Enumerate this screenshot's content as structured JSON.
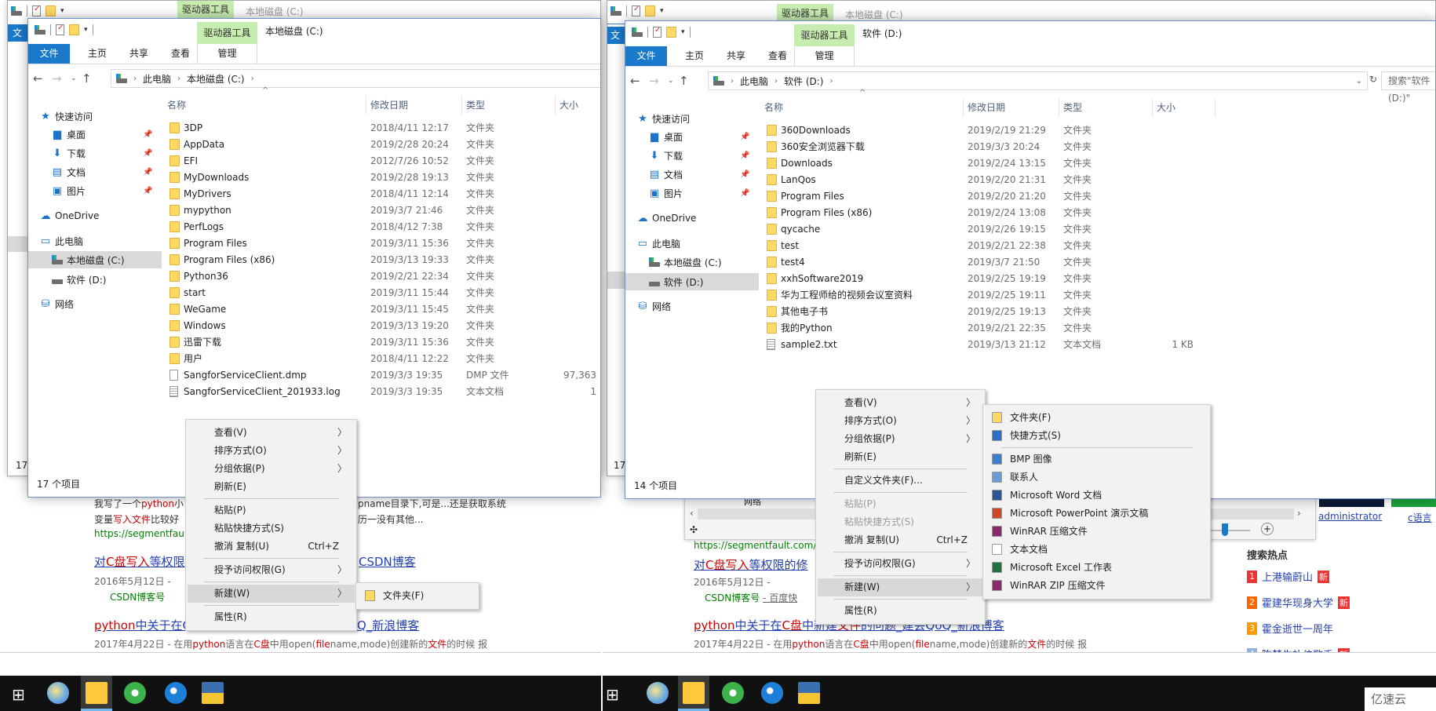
{
  "background_windows": [
    {
      "context_tab": "驱动器工具",
      "title": "本地磁盘 (C:)",
      "file_tab": "文",
      "status_fragment": "17"
    },
    {
      "context_tab": "驱动器工具",
      "title": "本地磁盘 (C:)",
      "file_tab": "文",
      "status_fragment": "17"
    }
  ],
  "windows": [
    {
      "context_tab": "驱动器工具",
      "title": "本地磁盘 (C:)",
      "tabs": [
        "文件",
        "主页",
        "共享",
        "查看"
      ],
      "context_subtab": "管理",
      "breadcrumb": [
        "此电脑",
        "本地磁盘 (C:)"
      ],
      "columns": [
        "名称",
        "修改日期",
        "类型",
        "大小"
      ],
      "nav": [
        {
          "label": "快速访问",
          "icon": "star",
          "level": 0
        },
        {
          "label": "桌面",
          "icon": "desktop",
          "level": 1,
          "pinned": true
        },
        {
          "label": "下载",
          "icon": "download",
          "level": 1,
          "pinned": true
        },
        {
          "label": "文档",
          "icon": "document",
          "level": 1,
          "pinned": true
        },
        {
          "label": "图片",
          "icon": "picture",
          "level": 1,
          "pinned": true
        },
        {
          "label": "OneDrive",
          "icon": "cloud",
          "level": 0
        },
        {
          "label": "此电脑",
          "icon": "computer",
          "level": 0
        },
        {
          "label": "本地磁盘 (C:)",
          "icon": "system-drive",
          "level": 1,
          "selected": true
        },
        {
          "label": "软件 (D:)",
          "icon": "drive",
          "level": 1
        },
        {
          "label": "网络",
          "icon": "network",
          "level": 0
        }
      ],
      "files": [
        {
          "name": "3DP",
          "date": "2018/4/11 12:17",
          "type": "文件夹",
          "size": "",
          "icon": "folder"
        },
        {
          "name": "AppData",
          "date": "2019/2/28 20:24",
          "type": "文件夹",
          "size": "",
          "icon": "folder"
        },
        {
          "name": "EFI",
          "date": "2012/7/26 10:52",
          "type": "文件夹",
          "size": "",
          "icon": "folder"
        },
        {
          "name": "MyDownloads",
          "date": "2019/2/28 19:13",
          "type": "文件夹",
          "size": "",
          "icon": "folder"
        },
        {
          "name": "MyDrivers",
          "date": "2018/4/11 12:14",
          "type": "文件夹",
          "size": "",
          "icon": "folder"
        },
        {
          "name": "mypython",
          "date": "2019/3/7 21:46",
          "type": "文件夹",
          "size": "",
          "icon": "folder"
        },
        {
          "name": "PerfLogs",
          "date": "2018/4/12 7:38",
          "type": "文件夹",
          "size": "",
          "icon": "folder"
        },
        {
          "name": "Program Files",
          "date": "2019/3/11 15:36",
          "type": "文件夹",
          "size": "",
          "icon": "folder"
        },
        {
          "name": "Program Files (x86)",
          "date": "2019/3/13 19:33",
          "type": "文件夹",
          "size": "",
          "icon": "folder"
        },
        {
          "name": "Python36",
          "date": "2019/2/21 22:34",
          "type": "文件夹",
          "size": "",
          "icon": "folder"
        },
        {
          "name": "start",
          "date": "2019/3/11 15:44",
          "type": "文件夹",
          "size": "",
          "icon": "folder"
        },
        {
          "name": "WeGame",
          "date": "2019/3/11 15:45",
          "type": "文件夹",
          "size": "",
          "icon": "folder"
        },
        {
          "name": "Windows",
          "date": "2019/3/13 19:20",
          "type": "文件夹",
          "size": "",
          "icon": "folder"
        },
        {
          "name": "迅雷下载",
          "date": "2019/3/11 15:36",
          "type": "文件夹",
          "size": "",
          "icon": "folder"
        },
        {
          "name": "用户",
          "date": "2018/4/11 12:22",
          "type": "文件夹",
          "size": "",
          "icon": "folder"
        },
        {
          "name": "SangforServiceClient.dmp",
          "date": "2019/3/3 19:35",
          "type": "DMP 文件",
          "size": "97,363",
          "icon": "file"
        },
        {
          "name": "SangforServiceClient_201933.log",
          "date": "2019/3/3 19:35",
          "type": "文本文档",
          "size": "1",
          "icon": "text-file"
        }
      ],
      "status": "17 个项目"
    },
    {
      "context_tab": "驱动器工具",
      "title": "软件 (D:)",
      "tabs": [
        "文件",
        "主页",
        "共享",
        "查看"
      ],
      "context_subtab": "管理",
      "breadcrumb": [
        "此电脑",
        "软件 (D:)"
      ],
      "search_placeholder": "搜索\"软件 (D:)\"",
      "columns": [
        "名称",
        "修改日期",
        "类型",
        "大小"
      ],
      "nav": [
        {
          "label": "快速访问",
          "icon": "star",
          "level": 0
        },
        {
          "label": "桌面",
          "icon": "desktop",
          "level": 1,
          "pinned": true
        },
        {
          "label": "下载",
          "icon": "download",
          "level": 1,
          "pinned": true
        },
        {
          "label": "文档",
          "icon": "document",
          "level": 1,
          "pinned": true
        },
        {
          "label": "图片",
          "icon": "picture",
          "level": 1,
          "pinned": true
        },
        {
          "label": "OneDrive",
          "icon": "cloud",
          "level": 0
        },
        {
          "label": "此电脑",
          "icon": "computer",
          "level": 0
        },
        {
          "label": "本地磁盘 (C:)",
          "icon": "system-drive",
          "level": 1
        },
        {
          "label": "软件 (D:)",
          "icon": "drive",
          "level": 1,
          "selected": true
        },
        {
          "label": "网络",
          "icon": "network",
          "level": 0
        }
      ],
      "files": [
        {
          "name": "360Downloads",
          "date": "2019/2/19 21:29",
          "type": "文件夹",
          "size": "",
          "icon": "folder"
        },
        {
          "name": "360安全浏览器下载",
          "date": "2019/3/3 20:24",
          "type": "文件夹",
          "size": "",
          "icon": "folder"
        },
        {
          "name": "Downloads",
          "date": "2019/2/24 13:15",
          "type": "文件夹",
          "size": "",
          "icon": "folder"
        },
        {
          "name": "LanQos",
          "date": "2019/2/20 21:31",
          "type": "文件夹",
          "size": "",
          "icon": "folder"
        },
        {
          "name": "Program Files",
          "date": "2019/2/20 21:20",
          "type": "文件夹",
          "size": "",
          "icon": "folder"
        },
        {
          "name": "Program Files (x86)",
          "date": "2019/2/24 13:08",
          "type": "文件夹",
          "size": "",
          "icon": "folder"
        },
        {
          "name": "qycache",
          "date": "2019/2/26 19:15",
          "type": "文件夹",
          "size": "",
          "icon": "folder"
        },
        {
          "name": "test",
          "date": "2019/2/21 22:38",
          "type": "文件夹",
          "size": "",
          "icon": "folder"
        },
        {
          "name": "test4",
          "date": "2019/3/7 21:50",
          "type": "文件夹",
          "size": "",
          "icon": "folder"
        },
        {
          "name": "xxhSoftware2019",
          "date": "2019/2/25 19:19",
          "type": "文件夹",
          "size": "",
          "icon": "folder"
        },
        {
          "name": "华为工程师给的视频会议室资料",
          "date": "2019/2/25 19:11",
          "type": "文件夹",
          "size": "",
          "icon": "folder"
        },
        {
          "name": "其他电子书",
          "date": "2019/2/25 19:13",
          "type": "文件夹",
          "size": "",
          "icon": "folder"
        },
        {
          "name": "我的Python",
          "date": "2019/2/21 22:35",
          "type": "文件夹",
          "size": "",
          "icon": "folder"
        },
        {
          "name": "sample2.txt",
          "date": "2019/3/13 21:12",
          "type": "文本文档",
          "size": "1 KB",
          "icon": "text-file"
        }
      ],
      "status": "14 个项目"
    }
  ],
  "context_menus": [
    {
      "items": [
        {
          "label": "查看(V)",
          "submenu": true
        },
        {
          "label": "排序方式(O)",
          "submenu": true
        },
        {
          "label": "分组依据(P)",
          "submenu": true
        },
        {
          "label": "刷新(E)"
        },
        {
          "separator": true
        },
        {
          "label": "粘贴(P)"
        },
        {
          "label": "粘贴快捷方式(S)"
        },
        {
          "label": "撤消 复制(U)",
          "shortcut": "Ctrl+Z"
        },
        {
          "separator": true
        },
        {
          "label": "授予访问权限(G)",
          "submenu": true
        },
        {
          "separator": true
        },
        {
          "label": "新建(W)",
          "submenu": true,
          "highlighted": true
        },
        {
          "separator": true
        },
        {
          "label": "属性(R)"
        }
      ],
      "submenu": [
        {
          "label": "文件夹(F)",
          "icon": "folder"
        }
      ]
    },
    {
      "items": [
        {
          "label": "查看(V)",
          "submenu": true
        },
        {
          "label": "排序方式(O)",
          "submenu": true
        },
        {
          "label": "分组依据(P)",
          "submenu": true
        },
        {
          "label": "刷新(E)"
        },
        {
          "separator": true
        },
        {
          "label": "自定义文件夹(F)..."
        },
        {
          "separator": true
        },
        {
          "label": "粘贴(P)",
          "disabled": true
        },
        {
          "label": "粘贴快捷方式(S)",
          "disabled": true
        },
        {
          "label": "撤消 复制(U)",
          "shortcut": "Ctrl+Z"
        },
        {
          "separator": true
        },
        {
          "label": "授予访问权限(G)",
          "submenu": true
        },
        {
          "separator": true
        },
        {
          "label": "新建(W)",
          "submenu": true,
          "highlighted": true
        },
        {
          "separator": true
        },
        {
          "label": "属性(R)"
        }
      ],
      "submenu": [
        {
          "label": "文件夹(F)",
          "icon": "folder"
        },
        {
          "label": "快捷方式(S)",
          "icon": "shortcut"
        },
        {
          "separator": true
        },
        {
          "label": "BMP 图像",
          "icon": "bmp"
        },
        {
          "label": "联系人",
          "icon": "contact"
        },
        {
          "label": "Microsoft Word 文档",
          "icon": "word"
        },
        {
          "label": "Microsoft PowerPoint 演示文稿",
          "icon": "powerpoint"
        },
        {
          "label": "WinRAR 压缩文件",
          "icon": "winrar"
        },
        {
          "label": "文本文档",
          "icon": "text-file"
        },
        {
          "label": "Microsoft Excel 工作表",
          "icon": "excel"
        },
        {
          "label": "WinRAR ZIP 压缩文件",
          "icon": "winrar"
        }
      ]
    }
  ],
  "browser_left": {
    "snippet1_a": "我写了一个",
    "snippet1_b": "python",
    "snippet1_c": "小",
    "snippet1_right": "pname目录下,可是...还是获取系统",
    "snippet2_a": "变量",
    "snippet2_b": "写入文件",
    "snippet2_c": "比较好",
    "snippet2_right": "历一没有其他...",
    "url": "https://segmentfault",
    "link1_a": "对",
    "link1_b": "C盘写入",
    "link1_c": "等权限",
    "link1_right": "CSDN博客",
    "date1": "2016年5月12日 -",
    "source1": "CSDN博客号",
    "link2_a": "python",
    "link2_b": "中关于在C",
    "link2_right": "Q_新浪博客",
    "snippet3_a": "2017年4月22日 - 在用",
    "snippet3_b": "python",
    "snippet3_c": "语言在",
    "snippet3_d": "C盘",
    "snippet3_e": "中用open(",
    "snippet3_f": "file",
    "snippet3_g": "name,mode)创建新的",
    "snippet3_h": "文件",
    "snippet3_i": "的时候 报"
  },
  "browser_right": {
    "behind_window_nav": "网络",
    "url": "https://segmentfault.com/q",
    "link1_a": "对",
    "link1_b": "C盘写入",
    "link1_c": "等权限的修",
    "date1": "2016年5月12日 -",
    "source1": "CSDN博客号",
    "source1_extra": "- 百度快",
    "link2_a": "python",
    "link2_b": "中关于在",
    "link2_c": "C盘",
    "link2_d": "中新建",
    "link2_e": "文件",
    "link2_f": "的问题_建会QoQ_新浪博客",
    "snippet3_a": "2017年4月22日 - 在用",
    "snippet3_b": "python",
    "snippet3_c": "语言在",
    "snippet3_d": "C盘",
    "snippet3_e": "中用open(",
    "snippet3_f": "file",
    "snippet3_g": "name,mode)创建新的",
    "snippet3_h": "文件",
    "snippet3_i": "的时候 报",
    "user_link": "administrator",
    "c_link": "c语言",
    "hot_title": "搜索热点",
    "hot_items": [
      {
        "rank": "1",
        "text": "上港输蔚山",
        "new": "新",
        "color": "#e33"
      },
      {
        "rank": "2",
        "text": "霍建华现身大学",
        "new": "新",
        "color": "#f60"
      },
      {
        "rank": "3",
        "text": "霍金逝世一周年",
        "new": "",
        "color": "#f90"
      },
      {
        "rank": "4",
        "text": "陈楚生补位歌手",
        "new": "新",
        "color": "#8fb0e0"
      }
    ]
  },
  "taskbar_apps": [
    "start",
    "paint",
    "file-explorer",
    "360-browser",
    "chat",
    "python-file"
  ],
  "watermark": "亿速云",
  "colors": {
    "ribbon_file_tab": "#1979ca",
    "context_tab": "#c7ecb0",
    "taskbar": "#111111",
    "link": "#2440b3",
    "highlight": "#cc0000"
  }
}
